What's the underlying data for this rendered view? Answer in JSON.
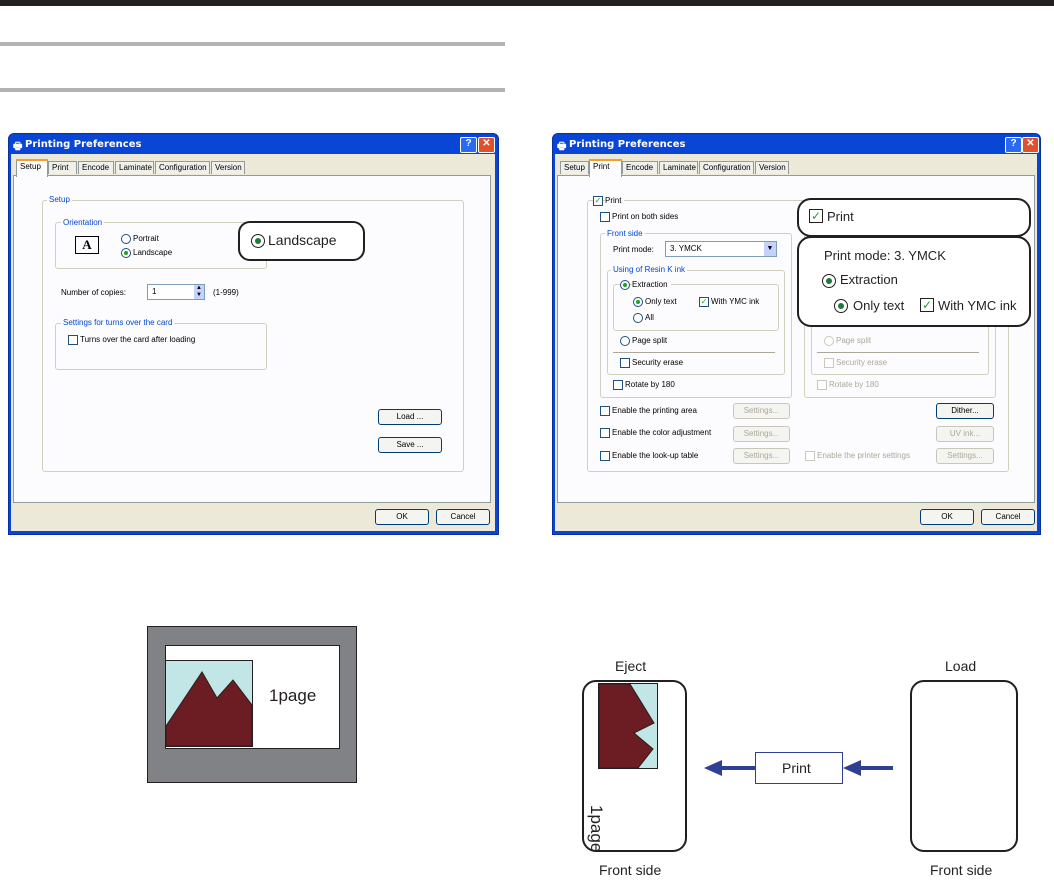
{
  "left_dialog": {
    "title": "Printing Preferences",
    "tabs": [
      "Setup",
      "Print",
      "Encode",
      "Laminate",
      "Configuration",
      "Version"
    ],
    "active_tab": "Setup",
    "setup_group": "Setup",
    "orientation_group": "Orientation",
    "portrait": "Portrait",
    "landscape": "Landscape",
    "orientation_selected": "Landscape",
    "copies_label": "Number of copies:",
    "copies_value": "1",
    "copies_range": "(1-999)",
    "turn_group": "Settings for turns over the card",
    "turn_checkbox": "Turns over the card after loading",
    "load": "Load ...",
    "save": "Save ...",
    "ok": "OK",
    "cancel": "Cancel",
    "callout": "Landscape"
  },
  "right_dialog": {
    "title": "Printing Preferences",
    "tabs": [
      "Setup",
      "Print",
      "Encode",
      "Laminate",
      "Configuration",
      "Version"
    ],
    "active_tab": "Print",
    "print": "Print",
    "both_sides": "Print on both sides",
    "front_side": "Front side",
    "print_mode_label": "Print mode:",
    "print_mode_value": "3. YMCK",
    "resin_group": "Using of Resin K ink",
    "extraction": "Extraction",
    "only_text": "Only text",
    "with_ymc": "With YMC ink",
    "all": "All",
    "page_split": "Page split",
    "security_erase": "Security erase",
    "rotate": "Rotate by 180",
    "enable_area": "Enable the printing area",
    "enable_color": "Enable the color adjustment",
    "enable_lut": "Enable the look-up table",
    "settings": "Settings...",
    "dither": "Dither...",
    "uv_ink": "UV ink...",
    "enable_printer": "Enable the printer settings",
    "ok": "OK",
    "cancel": "Cancel",
    "callout_print": "Print",
    "callout_mode": "Print mode:  3. YMCK",
    "callout_extraction": "Extraction",
    "callout_only_text": "Only text",
    "callout_with_ymc": "With YMC ink"
  },
  "diagram_left": {
    "page_label": "1page"
  },
  "diagram_right": {
    "eject": "Eject",
    "load": "Load",
    "print": "Print",
    "page_label": "1page",
    "front_side_left": "Front side",
    "front_side_right": "Front side"
  }
}
